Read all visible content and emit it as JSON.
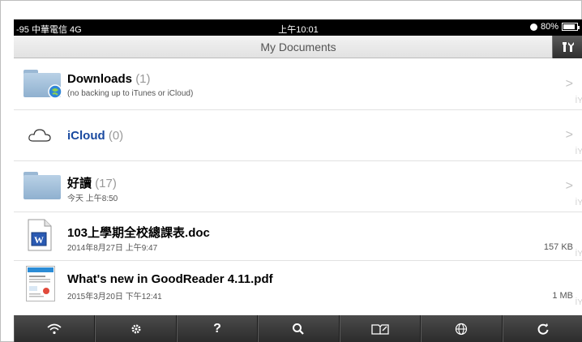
{
  "status_bar": {
    "left": "-95 中華電信  4G",
    "time": "上午10:01",
    "battery": "80%"
  },
  "nav": {
    "title": "My Documents",
    "tools_icon": "tools-icon"
  },
  "items": [
    {
      "name": "Downloads",
      "count": "(1)",
      "subtitle": "(no backing up to iTunes or iCloud)",
      "icon": "downloads-folder-icon",
      "accessory": "chevron"
    },
    {
      "name": "iCloud",
      "count": "(0)",
      "subtitle": "",
      "icon": "cloud-icon",
      "accessory": "chevron"
    },
    {
      "name": "好讀",
      "count": "(17)",
      "subtitle": "今天 上午8:50",
      "icon": "folder-icon",
      "accessory": "chevron"
    },
    {
      "name": "103上學期全校總課表.doc",
      "count": "",
      "subtitle": "2014年8月27日 上午9:47",
      "icon": "word-doc-icon",
      "size": "157 KB"
    },
    {
      "name": "What's new in GoodReader 4.11.pdf",
      "count": "",
      "subtitle": "2015年3月20日 下午12:41",
      "icon": "pdf-thumbnail-icon",
      "size": "1 MB"
    }
  ],
  "colors": {
    "icloud_text": "#1a4aa0",
    "toolbar_bg": "#3a3a3a",
    "folder_blue": "#a9c4de"
  },
  "toolbar": {
    "items": [
      "wifi-icon",
      "gear-icon",
      "help-icon",
      "search-icon",
      "reader-icon",
      "web-icon",
      "refresh-icon"
    ],
    "help_label": "?"
  }
}
